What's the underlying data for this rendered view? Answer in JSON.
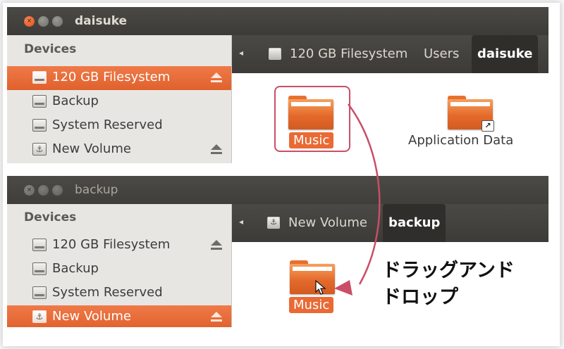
{
  "window_top": {
    "title": "daisuke",
    "controls": {
      "close": "×",
      "minimize": "−",
      "maximize": "□"
    },
    "sidebar": {
      "heading": "Devices",
      "items": [
        {
          "label": "120 GB Filesystem",
          "icon": "drive-icon",
          "selected": true,
          "eject": true
        },
        {
          "label": "Backup",
          "icon": "drive-icon",
          "selected": false,
          "eject": false
        },
        {
          "label": "System Reserved",
          "icon": "drive-icon",
          "selected": false,
          "eject": false
        },
        {
          "label": "New Volume",
          "icon": "usb-drive-icon",
          "selected": false,
          "eject": true
        }
      ]
    },
    "pathbar": {
      "back": "◂",
      "crumbs": [
        "120 GB Filesystem",
        "Users",
        "daisuke"
      ]
    },
    "files": [
      {
        "name": "Music",
        "selected": true
      },
      {
        "name": "Application Data",
        "selected": false,
        "symlink": true
      }
    ]
  },
  "window_bottom": {
    "title": "backup",
    "controls": {
      "close": "×",
      "minimize": "−",
      "maximize": "□"
    },
    "sidebar": {
      "heading": "Devices",
      "items": [
        {
          "label": "120 GB Filesystem",
          "icon": "drive-icon",
          "selected": false,
          "eject": true
        },
        {
          "label": "Backup",
          "icon": "drive-icon",
          "selected": false,
          "eject": false
        },
        {
          "label": "System Reserved",
          "icon": "drive-icon",
          "selected": false,
          "eject": false
        },
        {
          "label": "New Volume",
          "icon": "usb-drive-icon",
          "selected": true,
          "eject": true
        }
      ]
    },
    "pathbar": {
      "back": "◂",
      "crumbs": [
        "New Volume",
        "backup"
      ]
    },
    "files": [
      {
        "name": "Music",
        "selected": true
      }
    ]
  },
  "annotation": {
    "line1": "ドラッグアンド",
    "line2": "ドロップ",
    "arrow_color": "#c94e66"
  },
  "colors": {
    "accent": "#e0612d",
    "titlebar": "#3c3b37",
    "sidebar_bg": "#e8e6e3"
  }
}
